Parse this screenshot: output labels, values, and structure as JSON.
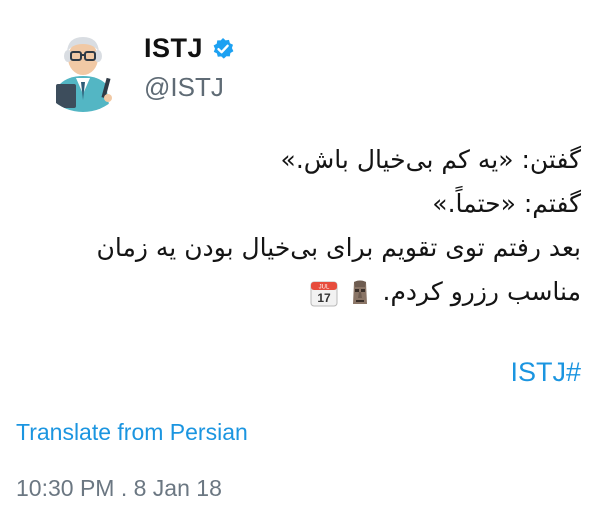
{
  "author": {
    "display_name": "ISTJ",
    "handle": "@ISTJ",
    "verified": true,
    "avatar_icon": "teacher-character-avatar-icon",
    "verified_icon": "verified-badge-icon"
  },
  "tweet": {
    "lines": [
      "گفتن: «یه کم بی‌خیال باش.»",
      "گفتم: «حتماً.»",
      "بعد رفتم توی تقویم برای بی‌خیال بودن یه زمان",
      "مناسب رزرو کردم."
    ],
    "emojis": [
      "calendar-icon",
      "moai-icon"
    ],
    "calendar_month": "JUL",
    "calendar_day": "17",
    "hashtag": "ISTJ#"
  },
  "translate_label": "Translate from Persian",
  "timestamp": "10:30 PM . 8 Jan 18",
  "colors": {
    "link": "#1b95e0",
    "verified": "#1da1f2",
    "muted": "#6b7782"
  }
}
